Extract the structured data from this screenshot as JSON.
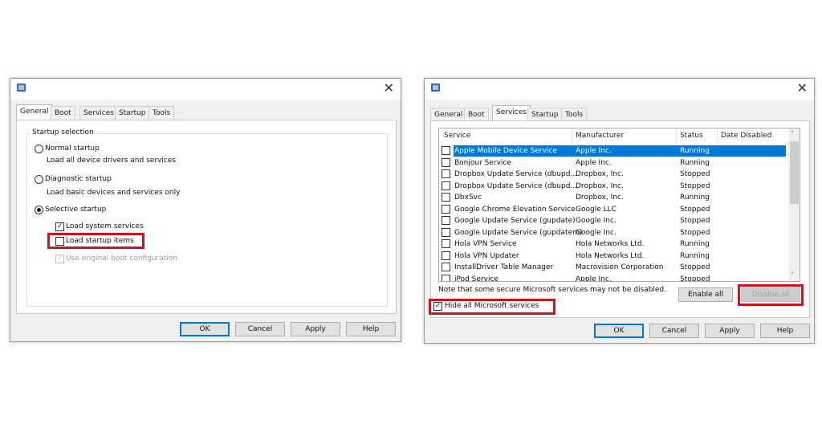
{
  "left_dialog": {
    "tabs": [
      "General",
      "Boot",
      "Services",
      "Startup",
      "Tools"
    ],
    "active_tab": "General",
    "group_title": "Startup selection",
    "normal": {
      "label": "Normal startup",
      "desc": "Load all device drivers and services",
      "selected": false
    },
    "diagnostic": {
      "label": "Diagnostic startup",
      "desc": "Load basic devices and services only",
      "selected": false
    },
    "selective": {
      "label": "Selective startup",
      "selected": true
    },
    "load_system_services": {
      "label": "Load system services",
      "checked": true
    },
    "load_startup_items": {
      "label": "Load startup items",
      "checked": false
    },
    "use_original_boot": {
      "label": "Use original boot configuration",
      "checked": true,
      "disabled": true
    },
    "buttons": {
      "ok": "OK",
      "cancel": "Cancel",
      "apply": "Apply",
      "help": "Help"
    }
  },
  "right_dialog": {
    "tabs": [
      "General",
      "Boot",
      "Services",
      "Startup",
      "Tools"
    ],
    "active_tab": "Services",
    "columns": [
      "Service",
      "Manufacturer",
      "Status",
      "Date Disabled"
    ],
    "rows": [
      {
        "service": "Apple Mobile Device Service",
        "manufacturer": "Apple Inc.",
        "status": "Running",
        "selected": true
      },
      {
        "service": "Bonjour Service",
        "manufacturer": "Apple Inc.",
        "status": "Running"
      },
      {
        "service": "Dropbox Update Service (dbupd...",
        "manufacturer": "Dropbox, Inc.",
        "status": "Stopped"
      },
      {
        "service": "Dropbox Update Service (dbupd...",
        "manufacturer": "Dropbox, Inc.",
        "status": "Stopped"
      },
      {
        "service": "DbxSvc",
        "manufacturer": "Dropbox, Inc.",
        "status": "Running"
      },
      {
        "service": "Google Chrome Elevation Service",
        "manufacturer": "Google LLC",
        "status": "Stopped"
      },
      {
        "service": "Google Update Service (gupdate)",
        "manufacturer": "Google Inc.",
        "status": "Stopped"
      },
      {
        "service": "Google Update Service (gupdatem)",
        "manufacturer": "Google Inc.",
        "status": "Stopped"
      },
      {
        "service": "Hola VPN Service",
        "manufacturer": "Hola Networks Ltd.",
        "status": "Running"
      },
      {
        "service": "Hola VPN Updater",
        "manufacturer": "Hola Networks Ltd.",
        "status": "Running"
      },
      {
        "service": "InstallDriver Table Manager",
        "manufacturer": "Macrovision Corporation",
        "status": "Stopped"
      },
      {
        "service": "iPod Service",
        "manufacturer": "Apple Inc.",
        "status": "Stopped"
      }
    ],
    "note": "Note that some secure Microsoft services may not be disabled.",
    "enable_all": "Enable all",
    "disable_all": "Disable all",
    "hide_ms": {
      "label": "Hide all Microsoft services",
      "checked": true
    },
    "buttons": {
      "ok": "OK",
      "cancel": "Cancel",
      "apply": "Apply",
      "help": "Help"
    }
  },
  "colors": {
    "highlight": "#d0141e",
    "selection": "#0078d7"
  }
}
